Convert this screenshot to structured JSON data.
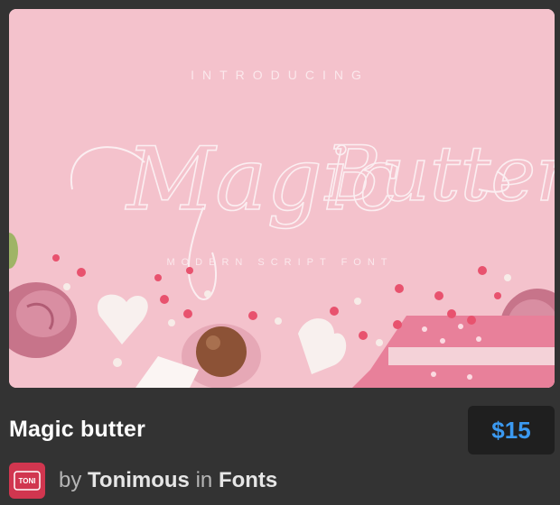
{
  "preview": {
    "intro_text": "INTRODUCING",
    "script_word_1": "Magic",
    "script_word_2": "Butter",
    "subtitle": "MODERN SCRIPT FONT"
  },
  "item": {
    "title": "Magic butter",
    "price": "$15"
  },
  "author": {
    "avatar_text": "TONI",
    "by_label": "by",
    "name": "Tonimous",
    "in_label": "in",
    "category": "Fonts"
  },
  "colors": {
    "background": "#333333",
    "price_accent": "#3b99f0",
    "preview_pink": "#f4c2cc",
    "avatar_red": "#d1364f"
  }
}
